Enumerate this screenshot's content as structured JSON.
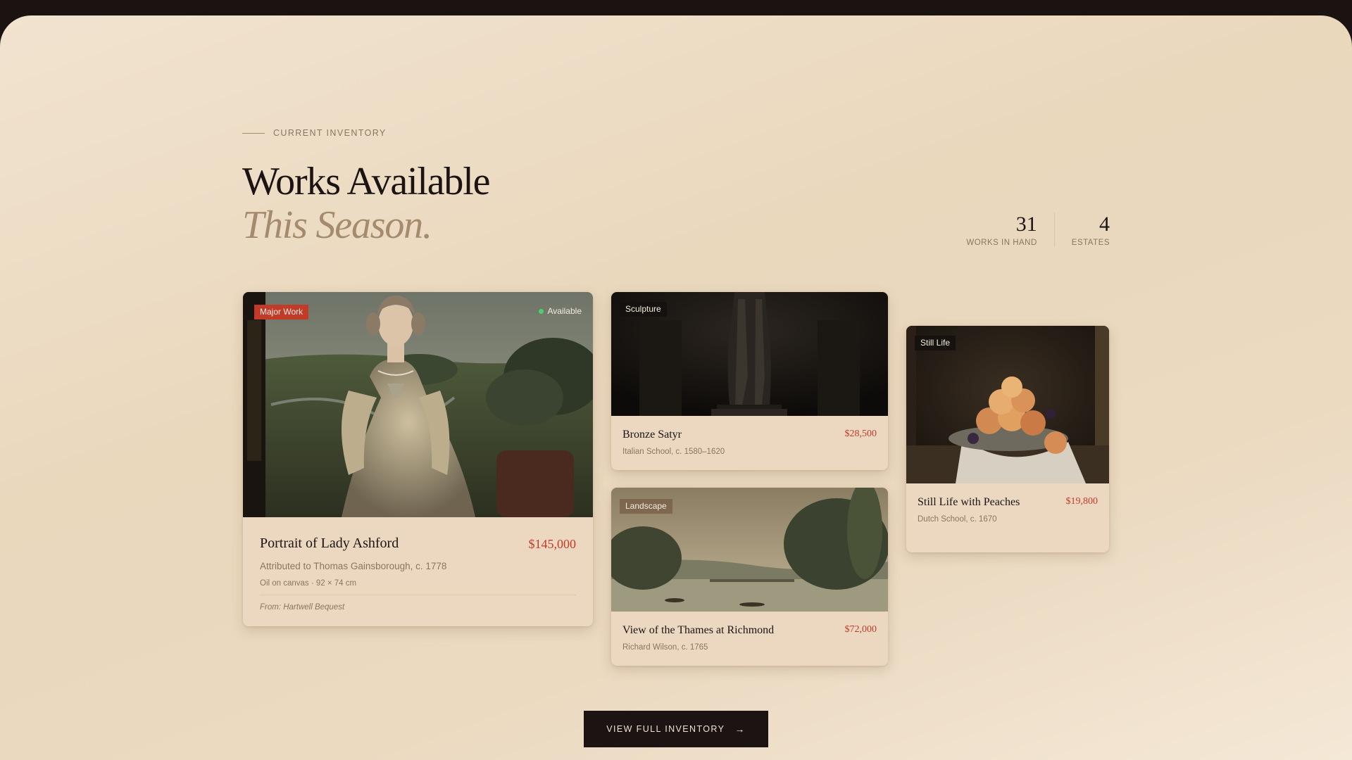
{
  "section": {
    "eyebrow": "CURRENT INVENTORY",
    "title_line1": "Works Available",
    "title_line2": "This Season."
  },
  "stats": [
    {
      "value": "31",
      "label": "WORKS IN HAND"
    },
    {
      "value": "4",
      "label": "ESTATES"
    }
  ],
  "cards": {
    "featured": {
      "tag": "Major Work",
      "status": "Available",
      "title": "Portrait of Lady Ashford",
      "price": "$145,000",
      "attribution": "Attributed to Thomas Gainsborough, c. 1778",
      "medium": "Oil on canvas · 92 × 74 cm",
      "provenance": "From: Hartwell Bequest"
    },
    "sculpture": {
      "tag": "Sculpture",
      "title": "Bronze Satyr",
      "price": "$28,500",
      "attribution": "Italian School, c. 1580–1620"
    },
    "landscape": {
      "tag": "Landscape",
      "title": "View of the Thames at Richmond",
      "price": "$72,000",
      "attribution": "Richard Wilson, c. 1765"
    },
    "still_life": {
      "tag": "Still Life",
      "title": "Still Life with Peaches",
      "price": "$19,800",
      "attribution": "Dutch School, c. 1670"
    }
  },
  "cta": {
    "label": "VIEW FULL INVENTORY",
    "icon": "arrow-right-icon"
  },
  "colors": {
    "accent": "#c23b29",
    "ink": "#1b1412",
    "muted": "#8a7561",
    "available": "#4cd06e"
  }
}
